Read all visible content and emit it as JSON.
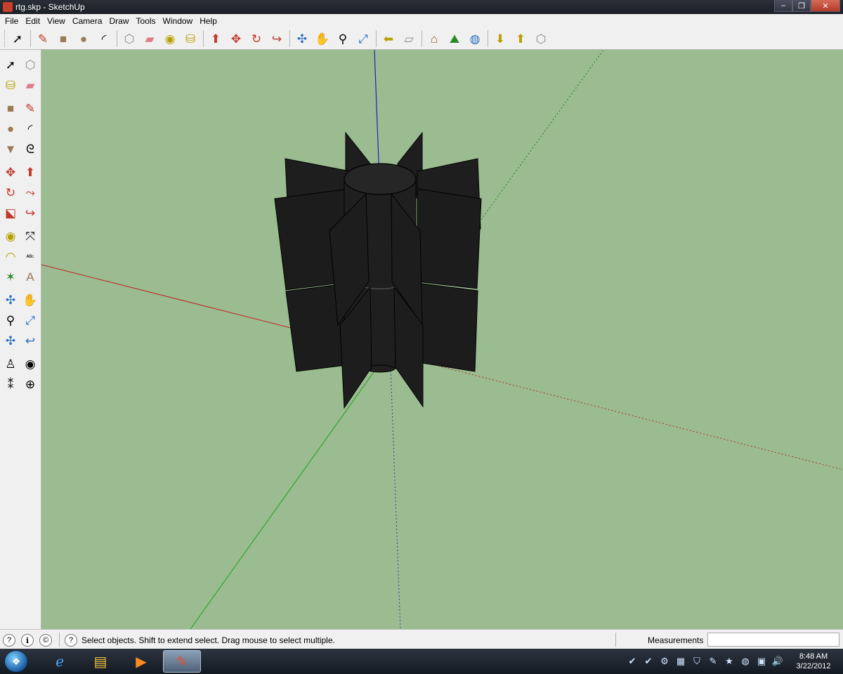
{
  "window": {
    "title": "rtg.skp - SketchUp",
    "minimize_glyph": "‒",
    "maximize_glyph": "❐",
    "close_glyph": "✕"
  },
  "menu": [
    "File",
    "Edit",
    "View",
    "Camera",
    "Draw",
    "Tools",
    "Window",
    "Help"
  ],
  "toolbar": [
    {
      "name": "select-tool-icon",
      "glyph": "➚"
    },
    {
      "sep": true
    },
    {
      "name": "pencil-line-icon",
      "glyph": "✎",
      "color": "#c0392b"
    },
    {
      "name": "rectangle-icon",
      "glyph": "■",
      "color": "#9b7a55"
    },
    {
      "name": "circle-icon",
      "glyph": "●",
      "color": "#9b7a55"
    },
    {
      "name": "arc-icon",
      "glyph": "◜"
    },
    {
      "sep": true
    },
    {
      "name": "make-component-icon",
      "glyph": "⬡",
      "color": "#888"
    },
    {
      "name": "eraser-icon",
      "glyph": "▰",
      "color": "#e07b8a"
    },
    {
      "name": "tape-measure-icon",
      "glyph": "◉",
      "color": "#b8a000"
    },
    {
      "name": "paint-bucket-icon",
      "glyph": "⛁",
      "color": "#b8a000"
    },
    {
      "sep": true
    },
    {
      "name": "push-pull-icon",
      "glyph": "⬆",
      "color": "#c0392b"
    },
    {
      "name": "move-icon",
      "glyph": "✥",
      "color": "#c0392b"
    },
    {
      "name": "rotate-icon",
      "glyph": "↻",
      "color": "#c0392b"
    },
    {
      "name": "offset-icon",
      "glyph": "↪",
      "color": "#c0392b"
    },
    {
      "sep": true
    },
    {
      "name": "orbit-icon",
      "glyph": "✣",
      "color": "#2a6fc0"
    },
    {
      "name": "pan-icon",
      "glyph": "✋"
    },
    {
      "name": "zoom-icon",
      "glyph": "⚲"
    },
    {
      "name": "zoom-extents-icon",
      "glyph": "⤢",
      "color": "#2a6fc0"
    },
    {
      "sep": true
    },
    {
      "name": "previous-view-icon",
      "glyph": "⬅",
      "color": "#b8a000"
    },
    {
      "name": "next-view-icon",
      "glyph": "▱",
      "color": "#888"
    },
    {
      "sep": true
    },
    {
      "name": "add-location-icon",
      "glyph": "⌂",
      "color": "#9b5a20"
    },
    {
      "name": "terrain-icon",
      "glyph": "⛰",
      "color": "#2a8a2a"
    },
    {
      "name": "google-earth-icon",
      "glyph": "◍",
      "color": "#2a6fc0"
    },
    {
      "sep": true
    },
    {
      "name": "get-models-icon",
      "glyph": "⬇",
      "color": "#b8a000"
    },
    {
      "name": "share-model-icon",
      "glyph": "⬆",
      "color": "#b8a000"
    },
    {
      "name": "share-component-icon",
      "glyph": "⬡",
      "color": "#888"
    }
  ],
  "palette": [
    [
      {
        "name": "select-tool-icon",
        "glyph": "➚"
      },
      {
        "name": "make-component-icon",
        "glyph": "⬡",
        "color": "#888"
      }
    ],
    [
      {
        "name": "paint-bucket-icon",
        "glyph": "⛁",
        "color": "#b8a000"
      },
      {
        "name": "eraser-icon",
        "glyph": "▰",
        "color": "#e07b8a"
      }
    ],
    "gap",
    [
      {
        "name": "rectangle-icon",
        "glyph": "■",
        "color": "#9b7a55"
      },
      {
        "name": "line-icon",
        "glyph": "✎",
        "color": "#c0392b"
      }
    ],
    [
      {
        "name": "circle-icon",
        "glyph": "●",
        "color": "#9b7a55"
      },
      {
        "name": "arc-icon",
        "glyph": "◜"
      }
    ],
    [
      {
        "name": "polygon-icon",
        "glyph": "▼",
        "color": "#9b7a55"
      },
      {
        "name": "freehand-icon",
        "glyph": "ᘓ"
      }
    ],
    "gap",
    [
      {
        "name": "move-icon",
        "glyph": "✥",
        "color": "#c0392b"
      },
      {
        "name": "push-pull-icon",
        "glyph": "⬆",
        "color": "#c0392b"
      }
    ],
    [
      {
        "name": "rotate-icon",
        "glyph": "↻",
        "color": "#c0392b"
      },
      {
        "name": "follow-me-icon",
        "glyph": "⤳",
        "color": "#c0392b"
      }
    ],
    [
      {
        "name": "scale-icon",
        "glyph": "⬕",
        "color": "#c0392b"
      },
      {
        "name": "offset-icon",
        "glyph": "↪",
        "color": "#c0392b"
      }
    ],
    "gap",
    [
      {
        "name": "tape-measure-icon",
        "glyph": "◉",
        "color": "#b8a000"
      },
      {
        "name": "dimensions-icon",
        "glyph": "⤧"
      }
    ],
    [
      {
        "name": "protractor-icon",
        "glyph": "◠",
        "color": "#b8a000"
      },
      {
        "name": "text-icon",
        "glyph": "ᴬᴮᶜ"
      }
    ],
    [
      {
        "name": "axes-icon",
        "glyph": "✶",
        "color": "#2a8a2a"
      },
      {
        "name": "3d-text-icon",
        "glyph": "A",
        "color": "#9b7a55"
      }
    ],
    "gap",
    [
      {
        "name": "orbit-icon",
        "glyph": "✣",
        "color": "#2a6fc0"
      },
      {
        "name": "pan-icon",
        "glyph": "✋"
      }
    ],
    [
      {
        "name": "zoom-icon",
        "glyph": "⚲"
      },
      {
        "name": "zoom-window-icon",
        "glyph": "⤢",
        "color": "#2a6fc0"
      }
    ],
    [
      {
        "name": "zoom-extents-icon",
        "glyph": "✣",
        "color": "#2a6fc0"
      },
      {
        "name": "previous-icon",
        "glyph": "↩",
        "color": "#2a6fc0"
      }
    ],
    "gap",
    [
      {
        "name": "position-camera-icon",
        "glyph": "♙"
      },
      {
        "name": "look-around-icon",
        "glyph": "◉"
      }
    ],
    [
      {
        "name": "walk-icon",
        "glyph": "⁑"
      },
      {
        "name": "section-plane-icon",
        "glyph": "⊕"
      }
    ]
  ],
  "status": {
    "icons": [
      "?",
      "ℹ",
      "©"
    ],
    "help_glyph": "?",
    "text": "Select objects. Shift to extend select. Drag mouse to select multiple.",
    "measurements_label": "Measurements",
    "measurements_value": ""
  },
  "taskbar": {
    "start_glyph": "❖",
    "items": [
      {
        "name": "internet-explorer-icon",
        "glyph": "ℯ",
        "color": "#4aa8ff"
      },
      {
        "name": "file-explorer-icon",
        "glyph": "▤",
        "color": "#f0c040"
      },
      {
        "name": "media-player-icon",
        "glyph": "▶",
        "color": "#ff8a20"
      },
      {
        "name": "sketchup-task-icon",
        "glyph": "✎",
        "color": "#e05030",
        "active": true
      }
    ],
    "tray_icons": [
      "✔",
      "✔",
      "⚙",
      "▦",
      "⛉",
      "✎",
      "★",
      "◍",
      "▣",
      "🔊"
    ],
    "time": "8:48 AM",
    "date": "3/22/2012"
  },
  "colors": {
    "viewport_bg": "#9abc90",
    "model_fill": "#1e1e1e",
    "axis_red": "#c02020",
    "axis_green": "#20a020",
    "axis_blue": "#2020c0"
  }
}
